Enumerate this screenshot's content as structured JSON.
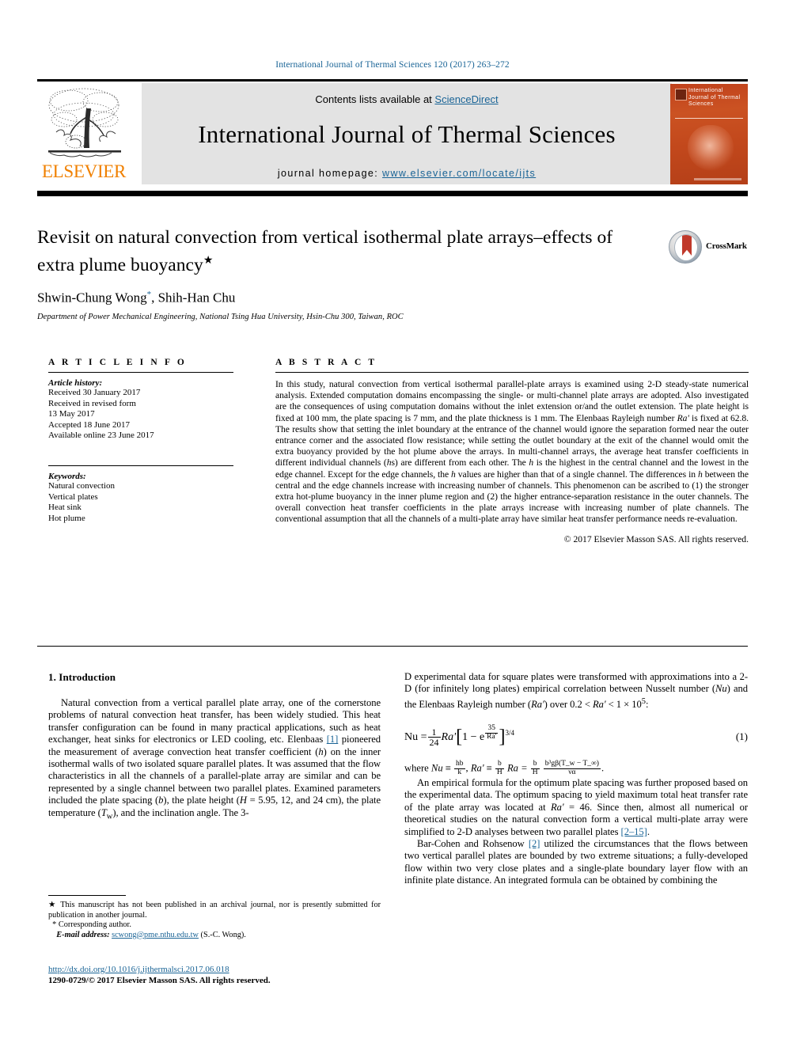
{
  "running_head": "International Journal of Thermal Sciences 120 (2017) 263–272",
  "masthead": {
    "contents_prefix": "Contents lists available at ",
    "sciencedirect": "ScienceDirect",
    "journal_title": "International Journal of Thermal Sciences",
    "homepage_prefix": "journal homepage: ",
    "homepage_url": "www.elsevier.com/locate/ijts",
    "publisher": "ELSEVIER",
    "cover_title": "International Journal of Thermal Sciences",
    "accent_link_color": "#1a6496",
    "elsevier_orange": "#f08000"
  },
  "title_block": {
    "title": "Revisit on natural convection from vertical isothermal plate arrays–effects of extra plume buoyancy",
    "title_footnote_mark": "★",
    "authors": "Shwin-Chung Wong",
    "author_star": "*",
    "authors_rest": ", Shih-Han Chu",
    "affiliation": "Department of Power Mechanical Engineering, National Tsing Hua University, Hsin-Chu 300, Taiwan, ROC",
    "crossmark_label": "CrossMark"
  },
  "article_info": {
    "heading": "A R T I C L E   I N F O",
    "history_label": "Article history:",
    "history": [
      "Received 30 January 2017",
      "Received in revised form",
      "13 May 2017",
      "Accepted 18 June 2017",
      "Available online 23 June 2017"
    ],
    "keywords_label": "Keywords:",
    "keywords": [
      "Natural convection",
      "Vertical plates",
      "Heat sink",
      "Hot plume"
    ]
  },
  "abstract": {
    "heading": "A B S T R A C T",
    "paragraph_1": "In this study, natural convection from vertical isothermal parallel-plate arrays is examined using 2-D steady-state numerical analysis. Extended computation domains encompassing the single- or multi-channel plate arrays are adopted. Also investigated are the consequences of using computation domains without the inlet extension or/and the outlet extension. The plate height is fixed at 100 mm, the plate spacing is 7 mm, and the plate thickness is 1 mm. The Elenbaas Rayleigh number ",
    "ra_symbol": "Ra'",
    "paragraph_2": " is fixed at 62.8. The results show that setting the inlet boundary at the entrance of the channel would ignore the separation formed near the outer entrance corner and the associated flow resistance; while setting the outlet boundary at the exit of the channel would omit the extra buoyancy provided by the hot plume above the arrays. In multi-channel arrays, the average heat transfer coefficients in different individual channels (",
    "h_symbol_1": "h",
    "paragraph_3": "s) are different from each other. The ",
    "h_symbol_2": "h",
    "paragraph_4": " is the highest in the central channel and the lowest in the edge channel. Except for the edge channels, the ",
    "h_symbol_3": "h",
    "paragraph_5": " values are higher than that of a single channel. The differences in ",
    "h_symbol_4": "h",
    "paragraph_6": " between the central and the edge channels increase with increasing number of channels. This phenomenon can be ascribed to (1) the stronger extra hot-plume buoyancy in the inner plume region and (2) the higher entrance-separation resistance in the outer channels. The overall convection heat transfer coefficients in the plate arrays increase with increasing number of plate channels. The conventional assumption that all the channels of a multi-plate array have similar heat transfer performance needs re-evaluation.",
    "copyright": "© 2017 Elsevier Masson SAS. All rights reserved."
  },
  "body": {
    "section_heading": "1. Introduction",
    "left_p1_a": "Natural convection from a vertical parallel plate array, one of the cornerstone problems of natural convection heat transfer, has been widely studied. This heat transfer configuration can be found in many practical applications, such as heat exchanger, heat sinks for electronics or LED cooling, etc. Elenbaas ",
    "left_ref1": "[1]",
    "left_p1_b": " pioneered the measurement of average convection heat transfer coefficient (",
    "left_h": "h",
    "left_p1_c": ") on the inner isothermal walls of two isolated square parallel plates. It was assumed that the flow characteristics in all the channels of a parallel-plate array are similar and can be represented by a single channel between two parallel plates. Examined parameters included the plate spacing (",
    "left_b": "b",
    "left_p1_d": "), the plate height (",
    "left_H": "H",
    "left_p1_e": " = 5.95, 12, and 24 cm), the plate temperature (",
    "left_Tw": "T",
    "left_Tw_sub": "w",
    "left_p1_f": "), and the inclination angle. The 3-",
    "right_p1_a": "D experimental data for square plates were transformed with approximations into a 2-D (for infinitely long plates) empirical correlation between Nusselt number (",
    "right_Nu": "Nu",
    "right_p1_b": ") and the Elenbaas Rayleigh number (",
    "right_Ra": "Ra'",
    "right_p1_c": ") over 0.2 < ",
    "right_Ra2": "Ra'",
    "right_p1_d": " < 1 × 10",
    "right_exp": "5",
    "right_p1_e": ":",
    "equation": {
      "lhs": "Nu =",
      "frac_num": "1",
      "frac_den": "24",
      "ra": "Ra'",
      "bracket_open": "[",
      "one_minus": "1 − e",
      "exp_frac_num": "35",
      "exp_frac_den": "Ra'",
      "bracket_close": "]",
      "power": "3/4",
      "number": "(1)"
    },
    "where_line": {
      "prefix": "where ",
      "nu": "Nu",
      "equiv1": " ≡ ",
      "f1_num": "hb",
      "f1_den": "k",
      "comma1": ", ",
      "ra": "Ra'",
      "equiv2": " ≡ ",
      "f2_num": "b",
      "f2_den": "H",
      "ra2": " Ra = ",
      "f3_num": "b",
      "f3_den": "H",
      "f4_num": "b³gβ(T_w − T_∞)",
      "f4_den": "να",
      "period": "."
    },
    "right_p2_a": "An empirical formula for the optimum plate spacing was further proposed based on the experimental data. The optimum spacing to yield maximum total heat transfer rate of the plate array was located at ",
    "right_Ra3": "Ra'",
    "right_p2_b": " = 46. Since then, almost all numerical or theoretical studies on the natural convection form a vertical multi-plate array were simplified to 2-D analyses between two parallel plates ",
    "right_ref2": "[2–15]",
    "right_p2_c": ".",
    "right_p3_a": "Bar-Cohen and Rohsenow ",
    "right_ref3": "[2]",
    "right_p3_b": " utilized the circumstances that the flows between two vertical parallel plates are bounded by two extreme situations; a fully-developed flow within two very close plates and a single-plate boundary layer flow with an infinite plate distance. An integrated formula can be obtained by combining the"
  },
  "footnotes": {
    "star_mark": "★",
    "star_text": "This manuscript has not been published in an archival journal, nor is presently submitted for publication in another journal.",
    "corr_mark": "*",
    "corr_text": "Corresponding author.",
    "email_label": "E-mail address:",
    "email": "scwong@pme.nthu.edu.tw",
    "email_suffix": "(S.-C. Wong)."
  },
  "footer": {
    "doi": "http://dx.doi.org/10.1016/j.ijthermalsci.2017.06.018",
    "issn_line": "1290-0729/© 2017 Elsevier Masson SAS. All rights reserved."
  }
}
